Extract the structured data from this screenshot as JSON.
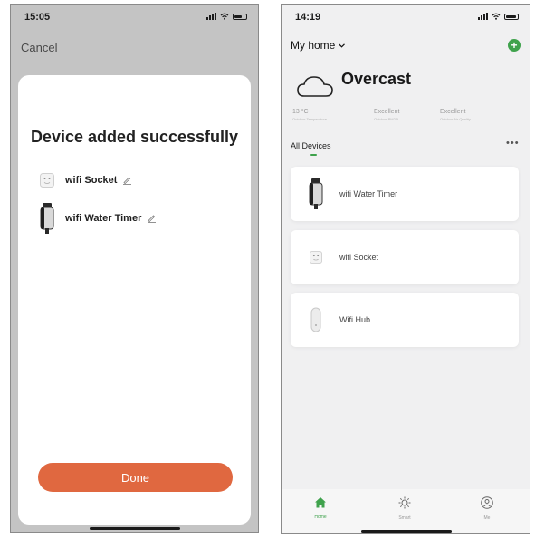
{
  "screen_added": {
    "status": {
      "time": "15:05"
    },
    "cancel_label": "Cancel",
    "title": "Device added successfully",
    "devices": [
      {
        "label": "wifi Socket",
        "icon": "socket-icon"
      },
      {
        "label": "wifi Water Timer",
        "icon": "water-timer-icon"
      }
    ],
    "done_label": "Done"
  },
  "screen_home": {
    "status": {
      "time": "14:19"
    },
    "home_label": "My home",
    "weather": {
      "condition": "Overcast",
      "metrics": [
        {
          "value": "13 °C",
          "caption": "Outdoor Temperature"
        },
        {
          "value": "Excellent",
          "caption": "Outdoor PM2.5"
        },
        {
          "value": "Excellent",
          "caption": "Outdoor Air Quality"
        }
      ]
    },
    "devices_heading": "All Devices",
    "more_label": "•••",
    "devices": [
      {
        "label": "wifi Water Timer",
        "icon": "water-timer-icon"
      },
      {
        "label": "wifi Socket",
        "icon": "socket-icon"
      },
      {
        "label": "Wifi Hub",
        "icon": "hub-icon"
      }
    ],
    "tabs": [
      {
        "label": "Home",
        "icon": "home-icon",
        "active": true
      },
      {
        "label": "Smart",
        "icon": "sun-icon",
        "active": false
      },
      {
        "label": "Me",
        "icon": "user-icon",
        "active": false
      }
    ]
  },
  "colors": {
    "accent_orange": "#e06840",
    "accent_green": "#3fa24c"
  }
}
